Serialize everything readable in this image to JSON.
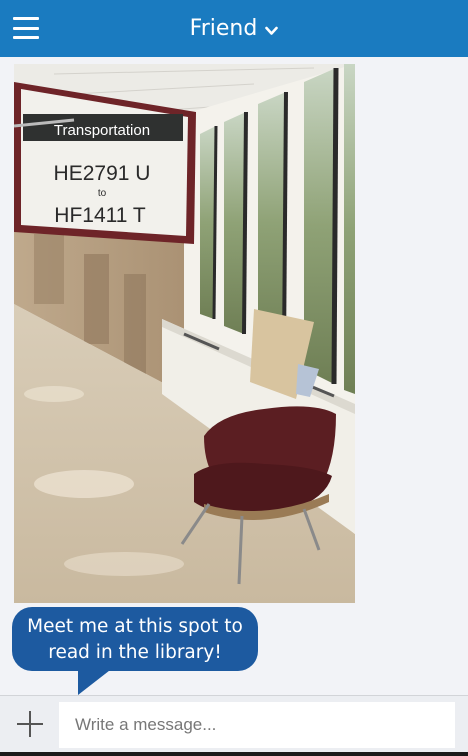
{
  "header": {
    "title": "Friend",
    "menu_icon": "hamburger-menu-icon",
    "dropdown_icon": "chevron-down-icon",
    "background": "#1a7bc0"
  },
  "message_photo": {
    "sign_heading": "Transportation",
    "sign_line1": "HE2791 U",
    "sign_line2": "to",
    "sign_line3": "HF1411 T"
  },
  "message_bubble": {
    "line1": "Meet me at this spot to",
    "line2": "read in the library!",
    "color": "#1d5aa0"
  },
  "composer": {
    "add_icon": "plus-icon",
    "placeholder": "Write a message..."
  }
}
